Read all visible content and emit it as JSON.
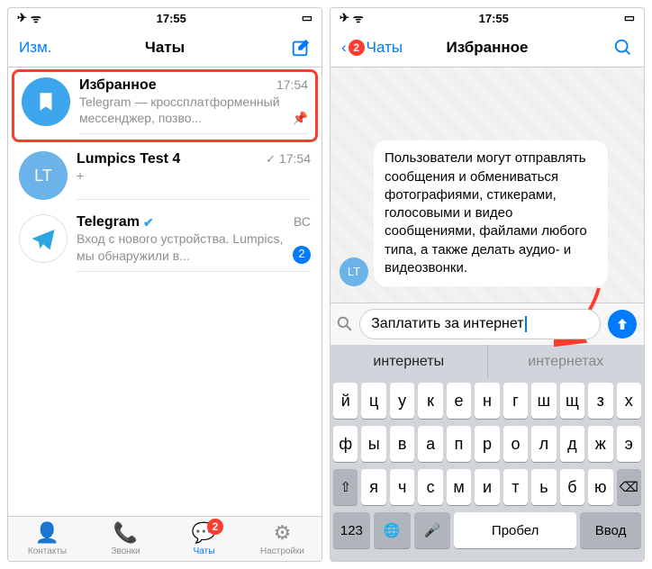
{
  "status": {
    "time": "17:55",
    "airplane": "✈︎",
    "wifi": "⋮",
    "battery": "▢"
  },
  "phone1": {
    "nav": {
      "left": "Изм.",
      "title": "Чаты"
    },
    "chats": [
      {
        "name": "Избранное",
        "time": "17:54",
        "preview": "Telegram — кроссплатформенный мессенджер, позво...",
        "avatar_text": ""
      },
      {
        "name": "Lumpics Test 4",
        "time": "17:54",
        "preview": "+",
        "avatar_text": "LT",
        "check": "✓"
      },
      {
        "name": "Telegram",
        "time": "ВС",
        "preview": "Вход с нового устройства. Lumpics, мы обнаружили в...",
        "unread": "2"
      }
    ],
    "tabs": {
      "contacts": "Контакты",
      "calls": "Звонки",
      "chats": "Чаты",
      "chats_badge": "2",
      "settings": "Настройки"
    }
  },
  "phone2": {
    "nav": {
      "back": "Чаты",
      "back_badge": "2",
      "title": "Избранное"
    },
    "message": "Пользователи могут отправлять сообщения и обмениваться фотографиями, стикерами, голосовыми и видео сообщениями, файлами любого типа, а также делать аудио- и видеозвонки.",
    "bubble_avatar": "LT",
    "input": "Заплатить за интернет",
    "suggestions": [
      "интернеты",
      "интернетах"
    ],
    "keyboard": {
      "row1": [
        "й",
        "ц",
        "у",
        "к",
        "е",
        "н",
        "г",
        "ш",
        "щ",
        "з",
        "х"
      ],
      "row2": [
        "ф",
        "ы",
        "в",
        "а",
        "п",
        "р",
        "о",
        "л",
        "д",
        "ж",
        "э"
      ],
      "row3_shift": "⇧",
      "row3": [
        "я",
        "ч",
        "с",
        "м",
        "и",
        "т",
        "ь",
        "б",
        "ю"
      ],
      "row3_del": "⌫",
      "row4_num": "123",
      "row4_globe": "🌐",
      "row4_mic": "🎤",
      "row4_space": "Пробел",
      "row4_enter": "Ввод"
    }
  }
}
